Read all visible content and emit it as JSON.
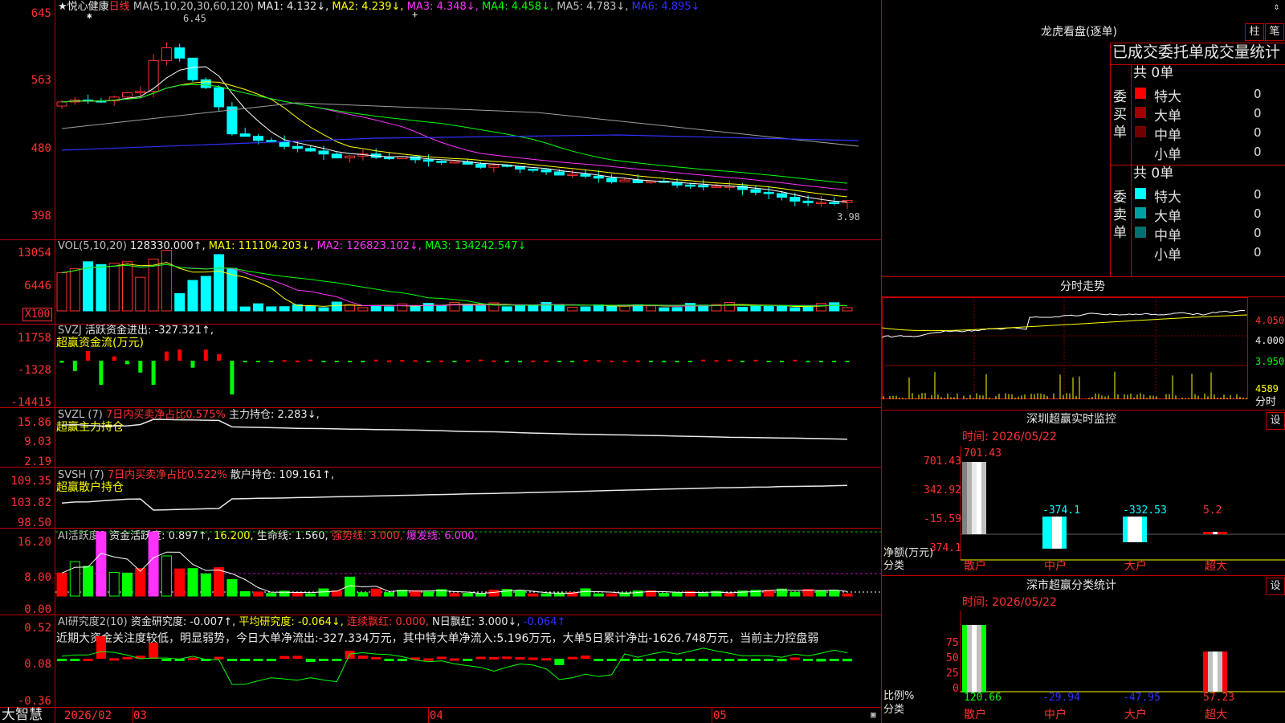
{
  "colors": {
    "up": "#ff3232",
    "down": "#00ffff",
    "border": "#c00000",
    "ma1": "#ffffff",
    "ma2": "#ffff00",
    "ma3": "#ff32ff",
    "ma4": "#00ff00",
    "ma5": "#808080",
    "ma6": "#3030ff"
  },
  "stock": {
    "name": "★悦心健康",
    "period": "日线"
  },
  "price_panel": {
    "ma_params": "MA(5,10,20,30,60,120)",
    "ma1": "MA1: 4.132↓,",
    "ma2": "MA2: 4.239↓,",
    "ma3": "MA3: 4.348↓,",
    "ma4": "MA4: 4.458↓,",
    "ma5": "MA5: 4.783↓,",
    "ma6": "MA6: 4.895↓",
    "y_labels": [
      "645",
      "563",
      "480",
      "398"
    ],
    "high_label": "6.45",
    "low_label": "3.98",
    "up_arrow": "↑",
    "plus": "+",
    "star": "✱"
  },
  "vol_panel": {
    "label": "VOL(5,10,20)",
    "value": "128330.000↑,",
    "ma1": "MA1: 111104.203↓,",
    "ma2": "MA2: 126823.102↓,",
    "ma3": "MA3: 134242.547↓",
    "y_labels": [
      "13054",
      "6446"
    ],
    "unit": "X100"
  },
  "svzj_panel": {
    "label": "SVZJ",
    "desc": "活跃资金进出: -327.321↑,",
    "subtitle": "超赢资金流(万元)",
    "y_labels": [
      "11758",
      "-1328",
      "-14415"
    ]
  },
  "svzl_panel": {
    "label": "SVZL (7)",
    "desc": "7日内买卖净占比0.575%",
    "hold": "主力持仓: 2.283↓,",
    "subtitle": "超赢主力持仓",
    "y_labels": [
      "15.86",
      "9.03",
      "2.19"
    ]
  },
  "svsh_panel": {
    "label": "SVSH (7)",
    "desc": "7日内买卖净占比0.522%",
    "hold": "散户持仓: 109.161↑,",
    "subtitle": "超赢散户持仓",
    "y_labels": [
      "109.35",
      "103.82",
      "98.50"
    ]
  },
  "ai_active": {
    "label": "AI活跃度2",
    "a": "资金活跃度: 0.897↑,",
    "b": "16.200,",
    "c": "生命线: 1.560,",
    "d": "强势线: 3.000,",
    "e": "爆发线: 6.000,",
    "y_labels": [
      "16.20",
      "8.00",
      "0.00"
    ]
  },
  "ai_research": {
    "label": "AI研究度2(10)",
    "a": "资金研究度: -0.007↑,",
    "b": "平均研究度: -0.064↓,",
    "c": "连续飘红: 0.000,",
    "d": "N日飘红: 3.000↓,",
    "e": "-0.064↑",
    "comment": "近期大资金关注度较低，明显弱势，今日大单净流出:-327.334万元，其中特大单净流入:5.196万元，大单5日累计净出-1626.748万元，当前主力控盘弱",
    "y_labels": [
      "0.52",
      "0.08",
      "-0.36"
    ]
  },
  "x_axis": {
    "brand": "大智慧",
    "labels": [
      "2026/02",
      "03",
      "04",
      "05"
    ]
  },
  "dragon": {
    "title": "龙虎看盘(逐单)",
    "btn1": "柱",
    "btn2": "笔",
    "header": "已成交委托单成交量统计",
    "buy": {
      "label": "委买单",
      "total": "共 0单",
      "rows": [
        {
          "name": "特大",
          "v1": "0",
          "v2": "0%",
          "color": "#ff0000"
        },
        {
          "name": "大单",
          "v1": "0",
          "v2": "0%",
          "color": "#a00000"
        },
        {
          "name": "中单",
          "v1": "0",
          "v2": "0%",
          "color": "#700000"
        },
        {
          "name": "小单",
          "v1": "0",
          "v2": "0%",
          "color": "#000000"
        }
      ]
    },
    "sell": {
      "label": "委卖单",
      "total": "共 0单",
      "rows": [
        {
          "name": "特大",
          "v1": "0",
          "v2": "0%",
          "color": "#00ffff"
        },
        {
          "name": "大单",
          "v1": "0",
          "v2": "0%",
          "color": "#00a0a0"
        },
        {
          "name": "中单",
          "v1": "0",
          "v2": "0%",
          "color": "#007070"
        },
        {
          "name": "小单",
          "v1": "0",
          "v2": "0%",
          "color": "#000000"
        }
      ]
    }
  },
  "intraday": {
    "title": "分时走势",
    "y_labels": [
      "4.050",
      "4.000",
      "3.950"
    ],
    "vol_label": "4589",
    "vol_unit": "分时"
  },
  "sz_monitor": {
    "title": "深圳超赢实时监控",
    "btn": "设",
    "time": "时间: 2026/05/22",
    "y_labels": [
      "701.43",
      "342.92",
      "-15.59",
      "-374.1"
    ],
    "ylabel": "净额(万元)",
    "xlabel": "分类",
    "bars": [
      {
        "cat": "散户",
        "value": "701.43"
      },
      {
        "cat": "中户",
        "value": "-374.1"
      },
      {
        "cat": "大户",
        "value": "-332.53"
      },
      {
        "cat": "超大",
        "value": "5.2"
      }
    ]
  },
  "sz_stats": {
    "title": "深市超赢分类统计",
    "btn": "设",
    "time": "时间: 2026/05/22",
    "y_labels": [
      "75",
      "50",
      "25",
      "0"
    ],
    "ylabel": "比例%",
    "xlabel": "分类",
    "bars": [
      {
        "cat": "散户",
        "value": "120.66"
      },
      {
        "cat": "中户",
        "value": "-29.94"
      },
      {
        "cat": "大户",
        "value": "-47.95"
      },
      {
        "cat": "超大",
        "value": "57.23"
      }
    ]
  },
  "top_arrow": "⇕"
}
